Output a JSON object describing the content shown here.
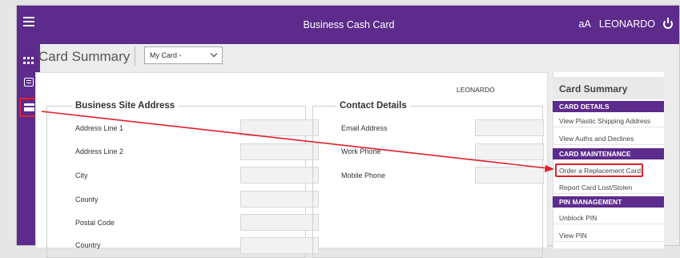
{
  "header": {
    "title": "Business Cash Card",
    "text_size": "aA",
    "user": "LEONARDO"
  },
  "sidebar": {
    "icons": [
      "apps-grid-icon",
      "list-icon",
      "card-icon"
    ]
  },
  "page": {
    "title": "Card Summary",
    "card_select": "My Card -"
  },
  "main": {
    "user_name": "LEONARDO",
    "business_site_address": {
      "legend": "Business Site Address",
      "fields": [
        "Address Line 1",
        "Address Line 2",
        "City",
        "County",
        "Postal Code",
        "Country"
      ]
    },
    "contact_details": {
      "legend": "Contact Details",
      "fields": [
        "Email Address",
        "Work Phone",
        "Mobile Phone"
      ]
    }
  },
  "summary_menu": {
    "title": "Card Summary",
    "sections": [
      {
        "header": "CARD DETAILS",
        "items": [
          "View Plastic Shipping Address",
          "View Auths and Declines"
        ]
      },
      {
        "header": "CARD MAINTENANCE",
        "items": [
          "Order a Replacement Card",
          "Report Card Lost/Stolen"
        ]
      },
      {
        "header": "PIN MANAGEMENT",
        "items": [
          "Unblock PIN",
          "View PIN"
        ]
      }
    ]
  },
  "colors": {
    "brand": "#5d2b8c",
    "highlight": "#e0202a"
  }
}
